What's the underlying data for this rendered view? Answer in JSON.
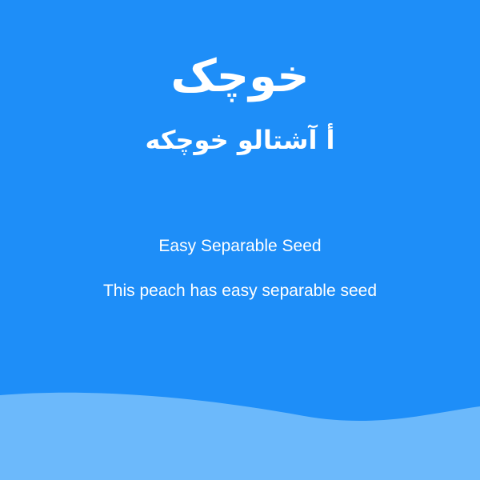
{
  "header": {
    "title": "خوچک",
    "subtitle": "أ آشتالو خوچکه"
  },
  "feature": {
    "title": "Easy Separable Seed",
    "description": "This peach has easy separable seed"
  },
  "colors": {
    "background": "#1e8ef8",
    "wave": "#6cb9fb",
    "text": "#ffffff"
  }
}
